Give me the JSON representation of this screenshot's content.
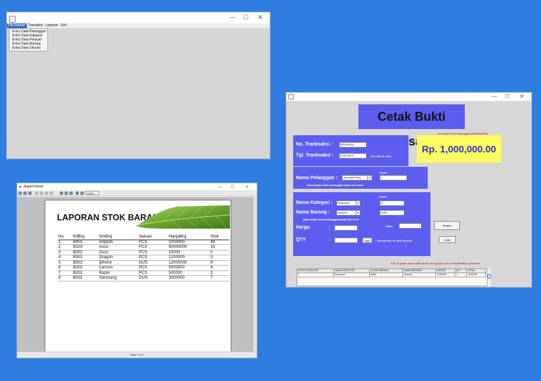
{
  "window1": {
    "menu": [
      "File Master",
      "Transaksi",
      "Laporan",
      "Exit"
    ],
    "dropdown": [
      "Entry Data Pelanggan",
      "Entry Data Kategori",
      "Entry Data Pelayan",
      "Entry Data Barang",
      "Entry Data Ukuran"
    ]
  },
  "window2": {
    "title": "JasperViewer",
    "zoom": "100%",
    "report_title": "LAPORAN STOK BARANG",
    "columns": [
      "No.",
      "KdBrg",
      "NmBrg",
      "Satuan",
      "HargaBrg",
      "Stok"
    ],
    "rows": [
      [
        "1",
        "B401",
        "Airpods",
        "PCS",
        "1000000",
        "49"
      ],
      [
        "2",
        "B103",
        "Asus",
        "PCS",
        "50000000",
        "15"
      ],
      [
        "3",
        "B302",
        "Asus",
        "PCS",
        "10000",
        "0"
      ],
      [
        "4",
        "B301",
        "Dragon",
        "PCS",
        "1200000",
        "0"
      ],
      [
        "5",
        "B502",
        "Iphone",
        "DUS",
        "12000000",
        "6"
      ],
      [
        "6",
        "B102",
        "Lenovo",
        "PCS",
        "5000000",
        "6"
      ],
      [
        "7",
        "B201",
        "Razer",
        "PCS",
        "500000",
        "2"
      ],
      [
        "8",
        "B501",
        "Samsung",
        "DUS",
        "3000000",
        "7"
      ]
    ],
    "page": "Page 1 of 1"
  },
  "window3": {
    "title": "Cetak Bukti Pesan",
    "kasir": "Jamowa Putra Wisanggu (2011500000)",
    "total": "Rp. 1,000,000.00",
    "no_transaksi_label": "No. Tranksaksi :",
    "no_transaksi_value": "BPS00023",
    "tgl_label": "Tgl. Tranksaksi :",
    "tgl_value": "2023-06-17",
    "tgl_hint": "Year  Month Date",
    "kode_label": "Kode :",
    "pelanggan_label": "Nama Pelanggan :",
    "pelanggan_value": "Jamowa Putra",
    "pelanggan_kode": "1",
    "pelanggan_hint": "Atau isikan kode pelanggan pada text kode",
    "kategori_label": "Nama Kategori :",
    "kategori_value": "Earphone",
    "kategori_kode": "4",
    "barang_label": "Nama Barang :",
    "barang_value": "Airpods",
    "barang_kode": "B401",
    "barang_hint": "Atau isikan kode pelanggan pada text kode",
    "harga_label": "Harga",
    "qty_label": "QTY",
    "colon": ":",
    "stok_label": "Stok :",
    "add_button": "Add",
    "add_hint": "* Tambahkan ke detil belanja",
    "simpan_button": "simpan",
    "batal_button": "batal",
    "table_hint": "Klik 2x pada baris data untuk mengubah atau membatalkan pesanan",
    "table_columns": [
      "KODE KATEGORI",
      "NAMA KATEGORI",
      "KODE BARANG",
      "NAMA BARANG",
      "HARGA",
      "QTY",
      "TOTAL"
    ],
    "table_rows": [
      [
        "4",
        "Earphone",
        "B401",
        "Airpods",
        "1000000",
        "1",
        "1000000"
      ]
    ]
  }
}
